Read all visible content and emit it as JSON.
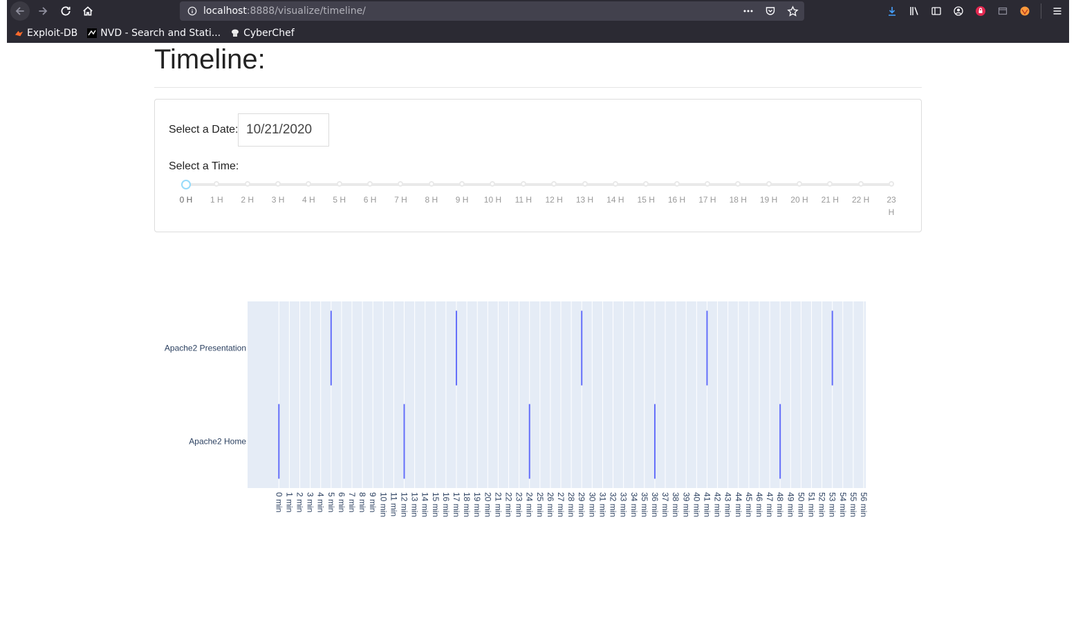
{
  "browser": {
    "url_host": "localhost",
    "url_rest": ":8888/visualize/timeline/",
    "bookmarks": [
      {
        "label": "Exploit-DB",
        "icon": "exploit-db-icon"
      },
      {
        "label": "NVD - Search and Stati...",
        "icon": "nvd-icon"
      },
      {
        "label": "CyberChef",
        "icon": "cyberchef-icon"
      }
    ]
  },
  "page": {
    "title": "Timeline:",
    "date_label": "Select a Date:",
    "date_value": "10/21/2020",
    "time_label": "Select a Time:",
    "time_marks": [
      "0 H",
      "1 H",
      "2 H",
      "3 H",
      "4 H",
      "5 H",
      "6 H",
      "7 H",
      "8 H",
      "9 H",
      "10 H",
      "11 H",
      "12 H",
      "13 H",
      "14 H",
      "15 H",
      "16 H",
      "17 H",
      "18 H",
      "19 H",
      "20 H",
      "21 H",
      "22 H",
      "23 H"
    ],
    "time_selected": 0
  },
  "chart_data": {
    "type": "scatter",
    "categories": [
      "Apache2 Home",
      "Apache2 Presentation"
    ],
    "x_tick_labels": [
      "0 min",
      "1 min",
      "2 min",
      "3 min",
      "4 min",
      "5 min",
      "6 min",
      "7 min",
      "8 min",
      "9 min",
      "10 min",
      "11 min",
      "12 min",
      "13 min",
      "14 min",
      "15 min",
      "16 min",
      "17 min",
      "18 min",
      "19 min",
      "20 min",
      "21 min",
      "22 min",
      "23 min",
      "24 min",
      "25 min",
      "26 min",
      "27 min",
      "28 min",
      "29 min",
      "30 min",
      "31 min",
      "32 min",
      "33 min",
      "34 min",
      "35 min",
      "36 min",
      "37 min",
      "38 min",
      "39 min",
      "40 min",
      "41 min",
      "42 min",
      "43 min",
      "44 min",
      "45 min",
      "46 min",
      "47 min",
      "48 min",
      "49 min",
      "50 min",
      "51 min",
      "52 min",
      "53 min",
      "54 min",
      "55 min",
      "56 min"
    ],
    "xlim": [
      -3,
      56.2
    ],
    "series": [
      {
        "category": "Apache2 Presentation",
        "x": [
          5,
          17,
          29,
          41,
          53
        ]
      },
      {
        "category": "Apache2 Home",
        "x": [
          0,
          12,
          24,
          36,
          48
        ]
      }
    ],
    "colors": {
      "plot_bg": "#e5ecf6",
      "grid": "#ffffff",
      "marker": "#636efa",
      "label": "#2a3f5f"
    }
  }
}
